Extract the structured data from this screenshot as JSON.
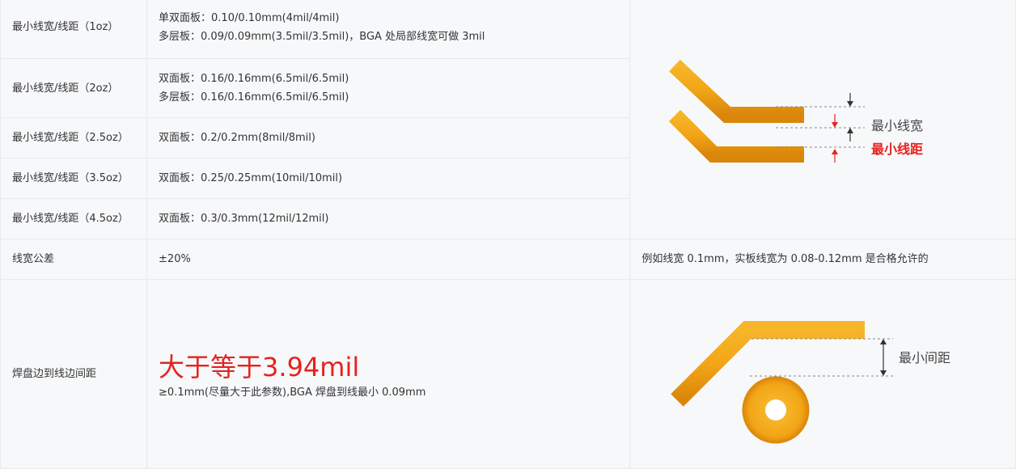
{
  "rows": [
    {
      "param": "最小线宽/线距（1oz）",
      "lines": [
        "单双面板：0.10/0.10mm(4mil/4mil)",
        "多层板：0.09/0.09mm(3.5mil/3.5mil)，BGA 处局部线宽可做 3mil"
      ]
    },
    {
      "param": "最小线宽/线距（2oz）",
      "lines": [
        "双面板：0.16/0.16mm(6.5mil/6.5mil)",
        "多层板：0.16/0.16mm(6.5mil/6.5mil)"
      ]
    },
    {
      "param": "最小线宽/线距（2.5oz）",
      "lines": [
        "双面板：0.2/0.2mm(8mil/8mil)"
      ]
    },
    {
      "param": "最小线宽/线距（3.5oz）",
      "lines": [
        "双面板：0.25/0.25mm(10mil/10mil)"
      ]
    },
    {
      "param": "最小线宽/线距（4.5oz）",
      "lines": [
        "双面板：0.3/0.3mm(12mil/12mil)"
      ]
    }
  ],
  "tolerance": {
    "param": "线宽公差",
    "value": "±20%",
    "note": "例如线宽 0.1mm，实板线宽为 0.08-0.12mm 是合格允许的"
  },
  "pad": {
    "param": "焊盘边到线边间距",
    "highlight": "大于等于3.94mil",
    "value": "≥0.1mm(尽量大于此参数),BGA 焊盘到线最小 0.09mm"
  },
  "diagram1": {
    "label_width": "最小线宽",
    "label_spacing": "最小线距",
    "label_width_color": "#444444",
    "label_spacing_color": "#e5231f"
  },
  "diagram2": {
    "label": "最小间距"
  },
  "colors": {
    "trace": "#f2a516",
    "trace_edge": "#e08a08",
    "highlight": "#e5231f",
    "border": "#e8e9ed"
  }
}
